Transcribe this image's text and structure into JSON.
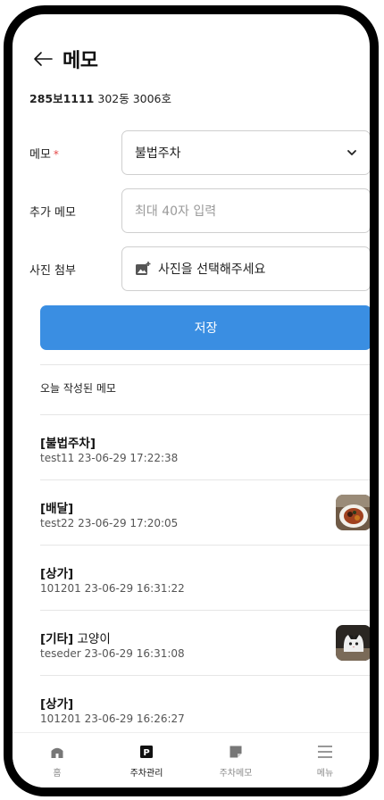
{
  "header": {
    "title": "메모"
  },
  "vehicle": {
    "plate": "285보1111",
    "address": " 302동 3006호"
  },
  "form": {
    "memo_label": "메모",
    "required_mark": "*",
    "memo_value": "불법주차",
    "extra_label": "추가 메모",
    "extra_placeholder": "최대 40자 입력",
    "photo_label": "사진 첨부",
    "photo_text": "사진을 선택해주세요",
    "save_label": "저장"
  },
  "today": {
    "title": "오늘 작성된 메모",
    "items": [
      {
        "tag": "[불법주차]",
        "text": "",
        "meta": "test11  23-06-29 17:22:38",
        "thumb": "none"
      },
      {
        "tag": "[배달]",
        "text": "",
        "meta": "test22  23-06-29 17:20:05",
        "thumb": "food"
      },
      {
        "tag": "[상가]",
        "text": "",
        "meta": "101201  23-06-29 16:31:22",
        "thumb": "none"
      },
      {
        "tag": "[기타]",
        "text": " 고양이",
        "meta": "teseder  23-06-29 16:31:08",
        "thumb": "cat"
      },
      {
        "tag": "[상가]",
        "text": "",
        "meta": "101201  23-06-29 16:26:27",
        "thumb": "none"
      }
    ]
  },
  "nav": {
    "items": [
      {
        "label": "홈",
        "icon": "home-icon",
        "active": false
      },
      {
        "label": "주차관리",
        "icon": "parking-icon",
        "active": true
      },
      {
        "label": "주차메모",
        "icon": "memo-icon",
        "active": false
      },
      {
        "label": "메뉴",
        "icon": "menu-icon",
        "active": false
      }
    ]
  },
  "colors": {
    "accent": "#3a8ee2",
    "required": "#e54848"
  }
}
